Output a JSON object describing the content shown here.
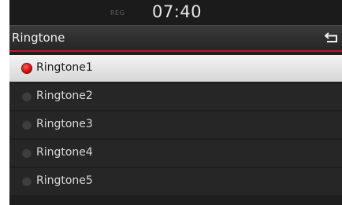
{
  "status": {
    "indicator": "REG",
    "time": "07:40"
  },
  "header": {
    "title": "Ringtone",
    "back_icon": "back-arrow-icon"
  },
  "colors": {
    "accent": "#c8102e",
    "selected_radio": "#d40000"
  },
  "list": {
    "items": [
      {
        "label": "Ringtone1",
        "selected": true
      },
      {
        "label": "Ringtone2",
        "selected": false
      },
      {
        "label": "Ringtone3",
        "selected": false
      },
      {
        "label": "Ringtone4",
        "selected": false
      },
      {
        "label": "Ringtone5",
        "selected": false
      }
    ]
  }
}
